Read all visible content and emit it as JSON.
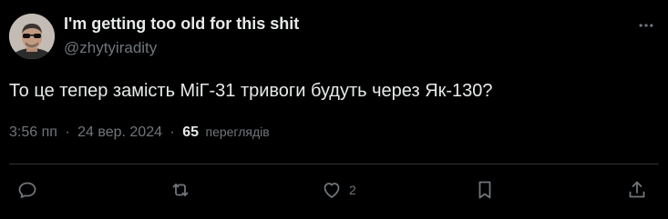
{
  "author": {
    "display_name": "I'm getting too old for this shit",
    "handle": "@zhytyiradity"
  },
  "tweet": {
    "text": "То це тепер замість МіГ-31 тривоги будуть через Як-130?",
    "time": "3:56 пп",
    "separator": "·",
    "date": "24 вер. 2024",
    "views_count": "65",
    "views_label": "переглядів"
  },
  "actions": {
    "reply": {
      "icon": "reply-icon"
    },
    "retweet": {
      "icon": "retweet-icon"
    },
    "like": {
      "icon": "heart-icon",
      "count": "2"
    },
    "bookmark": {
      "icon": "bookmark-icon"
    },
    "share": {
      "icon": "share-icon"
    }
  },
  "colors": {
    "background": "#000000",
    "text_primary": "#e7e9ea",
    "text_secondary": "#71767b",
    "divider": "#2f3336"
  }
}
